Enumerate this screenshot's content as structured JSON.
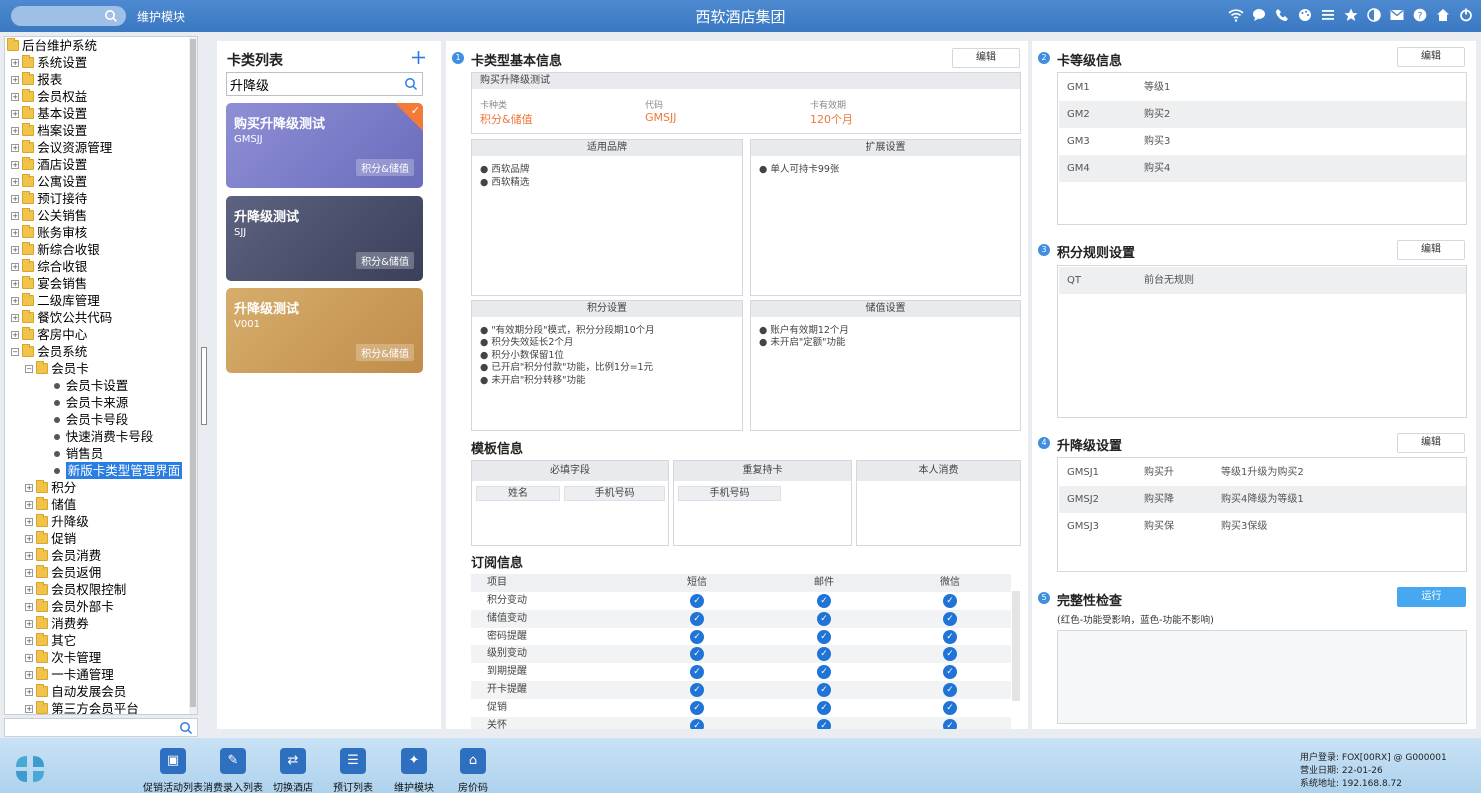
{
  "topbar": {
    "module": "维护模块",
    "company": "西软酒店集团",
    "icons": [
      "wifi-icon",
      "chat-icon",
      "phone-icon",
      "palette-icon",
      "menu-icon",
      "star-icon",
      "theme-icon",
      "mail-icon",
      "help-icon",
      "home-icon",
      "power-icon"
    ]
  },
  "tree": {
    "root": "后台维护系统",
    "top": [
      "系统设置",
      "报表",
      "会员权益",
      "基本设置",
      "档案设置",
      "会议资源管理",
      "酒店设置",
      "公寓设置",
      "预订接待",
      "公关销售",
      "账务审核",
      "新综合收银",
      "综合收银",
      "宴会销售",
      "二级库管理",
      "餐饮公共代码",
      "客房中心",
      "会员系统"
    ],
    "member_card": "会员卡",
    "member_card_children": [
      "会员卡设置",
      "会员卡来源",
      "会员卡号段",
      "快速消费卡号段",
      "销售员",
      "新版卡类型管理界面"
    ],
    "member_sub": [
      "积分",
      "储值",
      "升降级",
      "促销",
      "会员消费",
      "会员返佣",
      "会员权限控制",
      "会员外部卡",
      "消费券",
      "其它",
      "次卡管理",
      "一卡通管理",
      "自动发展会员",
      "第三方会员平台"
    ]
  },
  "card_list": {
    "title": "卡类列表",
    "search_value": "升降级",
    "cards": [
      {
        "name": "购买升降级测试",
        "code": "GMSJJ",
        "tag": "积分&储值"
      },
      {
        "name": "升降级测试",
        "code": "SJJ",
        "tag": "积分&储值"
      },
      {
        "name": "升降级测试",
        "code": "V001",
        "tag": "积分&储值"
      }
    ]
  },
  "basic": {
    "num": "1",
    "title": "卡类型基本信息",
    "edit": "编辑",
    "card_name": "购买升降级测试",
    "kind_label": "卡种类",
    "kind_value": "积分&储值",
    "code_label": "代码",
    "code_value": "GMSJJ",
    "valid_label": "卡有效期",
    "valid_value": "120个月",
    "brand_header": "适用品牌",
    "brands": [
      "西软品牌",
      "西软精选"
    ],
    "ext_header": "扩展设置",
    "ext_items": [
      "单人可持卡99张"
    ],
    "points_header": "积分设置",
    "points_items": [
      "\"有效期分段\"模式，积分分段期10个月",
      "积分失效延长2个月",
      "积分小数保留1位",
      "已开启\"积分付款\"功能，比例1分=1元",
      "未开启\"积分转移\"功能"
    ],
    "stored_header": "储值设置",
    "stored_items": [
      "账户有效期12个月",
      "未开启\"定额\"功能"
    ]
  },
  "template": {
    "title": "模板信息",
    "required_header": "必填字段",
    "required": [
      "姓名",
      "手机号码"
    ],
    "dup_header": "重复持卡",
    "dup": [
      "手机号码"
    ],
    "self_header": "本人消费"
  },
  "subscription": {
    "title": "订阅信息",
    "headers": [
      "项目",
      "短信",
      "邮件",
      "微信"
    ],
    "rows": [
      "积分变动",
      "储值变动",
      "密码提醒",
      "级别变动",
      "到期提醒",
      "开卡提醒",
      "促销",
      "关怀"
    ]
  },
  "level": {
    "num": "2",
    "title": "卡等级信息",
    "edit": "编辑",
    "rows": [
      [
        "GM1",
        "等级1"
      ],
      [
        "GM2",
        "购买2"
      ],
      [
        "GM3",
        "购买3"
      ],
      [
        "GM4",
        "购买4"
      ]
    ]
  },
  "points_rule": {
    "num": "3",
    "title": "积分规则设置",
    "edit": "编辑",
    "rows": [
      [
        "QT",
        "前台无规则"
      ]
    ]
  },
  "upgrade": {
    "num": "4",
    "title": "升降级设置",
    "edit": "编辑",
    "rows": [
      [
        "GMSJ1",
        "购买升",
        "等级1升级为购买2"
      ],
      [
        "GMSJ2",
        "购买降",
        "购买4降级为等级1"
      ],
      [
        "GMSJ3",
        "购买保",
        "购买3保级"
      ]
    ]
  },
  "integrity": {
    "num": "5",
    "title": "完整性检查",
    "run": "运行",
    "note": "(红色-功能受影响，蓝色-功能不影响)"
  },
  "bottom": {
    "buttons": [
      {
        "label": "促销活动列表",
        "icon": "calendar-icon"
      },
      {
        "label": "消费录入列表",
        "icon": "edit-doc-icon"
      },
      {
        "label": "切换酒店",
        "icon": "switch-icon"
      },
      {
        "label": "预订列表",
        "icon": "list-doc-icon"
      },
      {
        "label": "维护模块",
        "icon": "wrench-icon"
      },
      {
        "label": "房价码",
        "icon": "house-icon"
      }
    ],
    "user_line": "用户登录:  FOX[00RX] @ G000001",
    "date_line": "营业日期:  22-01-26",
    "addr_line": "系统地址:  192.168.8.72"
  }
}
